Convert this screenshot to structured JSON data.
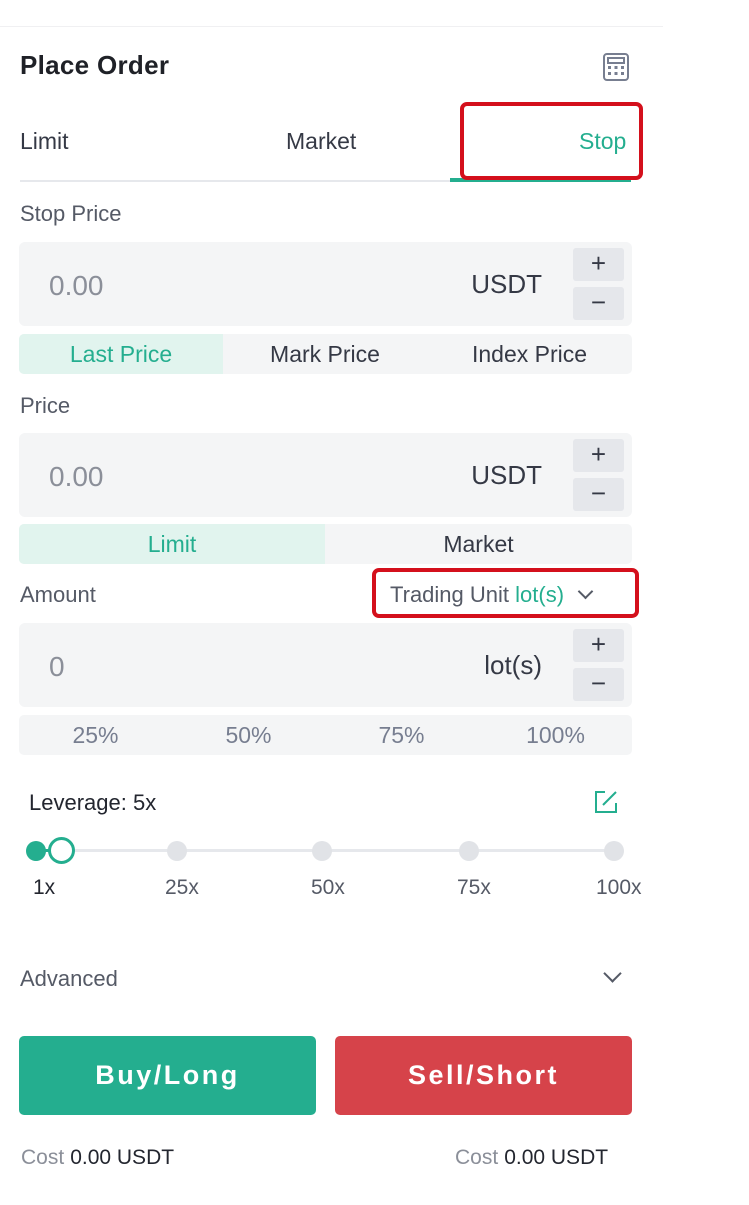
{
  "panel": {
    "title": "Place Order",
    "calculator_icon": "calculator-icon"
  },
  "tabs": [
    {
      "label": "Limit"
    },
    {
      "label": "Market"
    },
    {
      "label": "Stop",
      "active": true
    }
  ],
  "stop_price": {
    "label": "Stop Price",
    "value": "0.00",
    "unit": "USDT",
    "plus": "+",
    "minus": "−",
    "trigger_options": [
      "Last Price",
      "Mark Price",
      "Index Price"
    ],
    "trigger_selected": "Last Price"
  },
  "price": {
    "label": "Price",
    "value": "0.00",
    "unit": "USDT",
    "plus": "+",
    "minus": "−",
    "type_options": [
      "Limit",
      "Market"
    ],
    "type_selected": "Limit"
  },
  "amount": {
    "label": "Amount",
    "trading_unit_label": "Trading Unit",
    "trading_unit_value": "lot(s)",
    "value": "0",
    "unit": "lot(s)",
    "plus": "+",
    "minus": "−",
    "percentages": [
      "25%",
      "50%",
      "75%",
      "100%"
    ]
  },
  "leverage": {
    "label": "Leverage: 5x",
    "current": 5,
    "ticks": [
      "1x",
      "25x",
      "50x",
      "75x",
      "100x"
    ],
    "edit_icon": "edit-icon"
  },
  "advanced": {
    "label": "Advanced"
  },
  "actions": {
    "buy_label": "Buy/Long",
    "sell_label": "Sell/Short"
  },
  "costs": [
    {
      "label": "Cost",
      "value": "0.00 USDT"
    },
    {
      "label": "Cost",
      "value": "0.00 USDT"
    }
  ],
  "colors": {
    "accent": "#24ae8f",
    "sell": "#d6434a",
    "highlight": "#d4101c"
  }
}
